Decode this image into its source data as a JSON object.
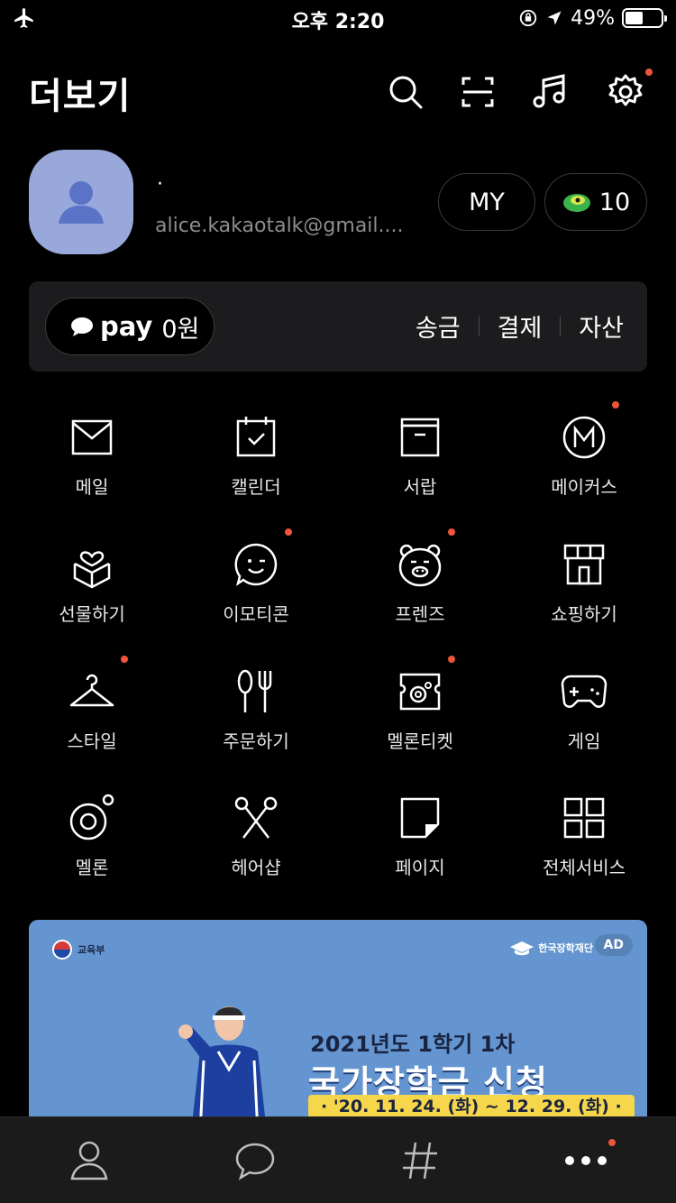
{
  "status_bar": {
    "time": "오후 2:20",
    "battery": "49%",
    "battery_level": 0.49
  },
  "header": {
    "title": "더보기"
  },
  "profile": {
    "name": "·",
    "email": "alice.kakaotalk@gmail....",
    "my_label": "MY",
    "coin_count": "10"
  },
  "pay": {
    "brand": "pay",
    "amount": "0원",
    "actions": [
      "송금",
      "결제",
      "자산"
    ]
  },
  "services": [
    {
      "label": "메일",
      "icon": "mail-icon",
      "badge": false
    },
    {
      "label": "캘린더",
      "icon": "calendar-icon",
      "badge": false
    },
    {
      "label": "서랍",
      "icon": "drawer-icon",
      "badge": false
    },
    {
      "label": "메이커스",
      "icon": "makers-icon",
      "badge": true
    },
    {
      "label": "선물하기",
      "icon": "gift-icon",
      "badge": false
    },
    {
      "label": "이모티콘",
      "icon": "emoticon-icon",
      "badge": true
    },
    {
      "label": "프렌즈",
      "icon": "friends-bear-icon",
      "badge": true
    },
    {
      "label": "쇼핑하기",
      "icon": "shopping-icon",
      "badge": false
    },
    {
      "label": "스타일",
      "icon": "hanger-icon",
      "badge": true
    },
    {
      "label": "주문하기",
      "icon": "fork-knife-icon",
      "badge": false
    },
    {
      "label": "멜론티켓",
      "icon": "ticket-icon",
      "badge": true
    },
    {
      "label": "게임",
      "icon": "gamepad-icon",
      "badge": false
    },
    {
      "label": "멜론",
      "icon": "melon-icon",
      "badge": false
    },
    {
      "label": "헤어샵",
      "icon": "scissors-icon",
      "badge": false
    },
    {
      "label": "페이지",
      "icon": "page-icon",
      "badge": false
    },
    {
      "label": "전체서비스",
      "icon": "grid-icon",
      "badge": false
    }
  ],
  "banner": {
    "ministry": "교육부",
    "org": "한국장학재단",
    "ad_label": "AD",
    "subtitle": "2021년도 1학기 1차",
    "title": "국가장학금 신청",
    "dates": "· '20. 11. 24. (화) ~ 12. 29. (화) ·"
  },
  "tabs": [
    "friends-tab",
    "chats-tab",
    "view-tab",
    "more-tab"
  ],
  "colors": {
    "accent_red": "#f0553b",
    "card_bg": "#1c1c1e",
    "avatar_bg": "#98a8da",
    "banner_bg": "#6495d0"
  }
}
